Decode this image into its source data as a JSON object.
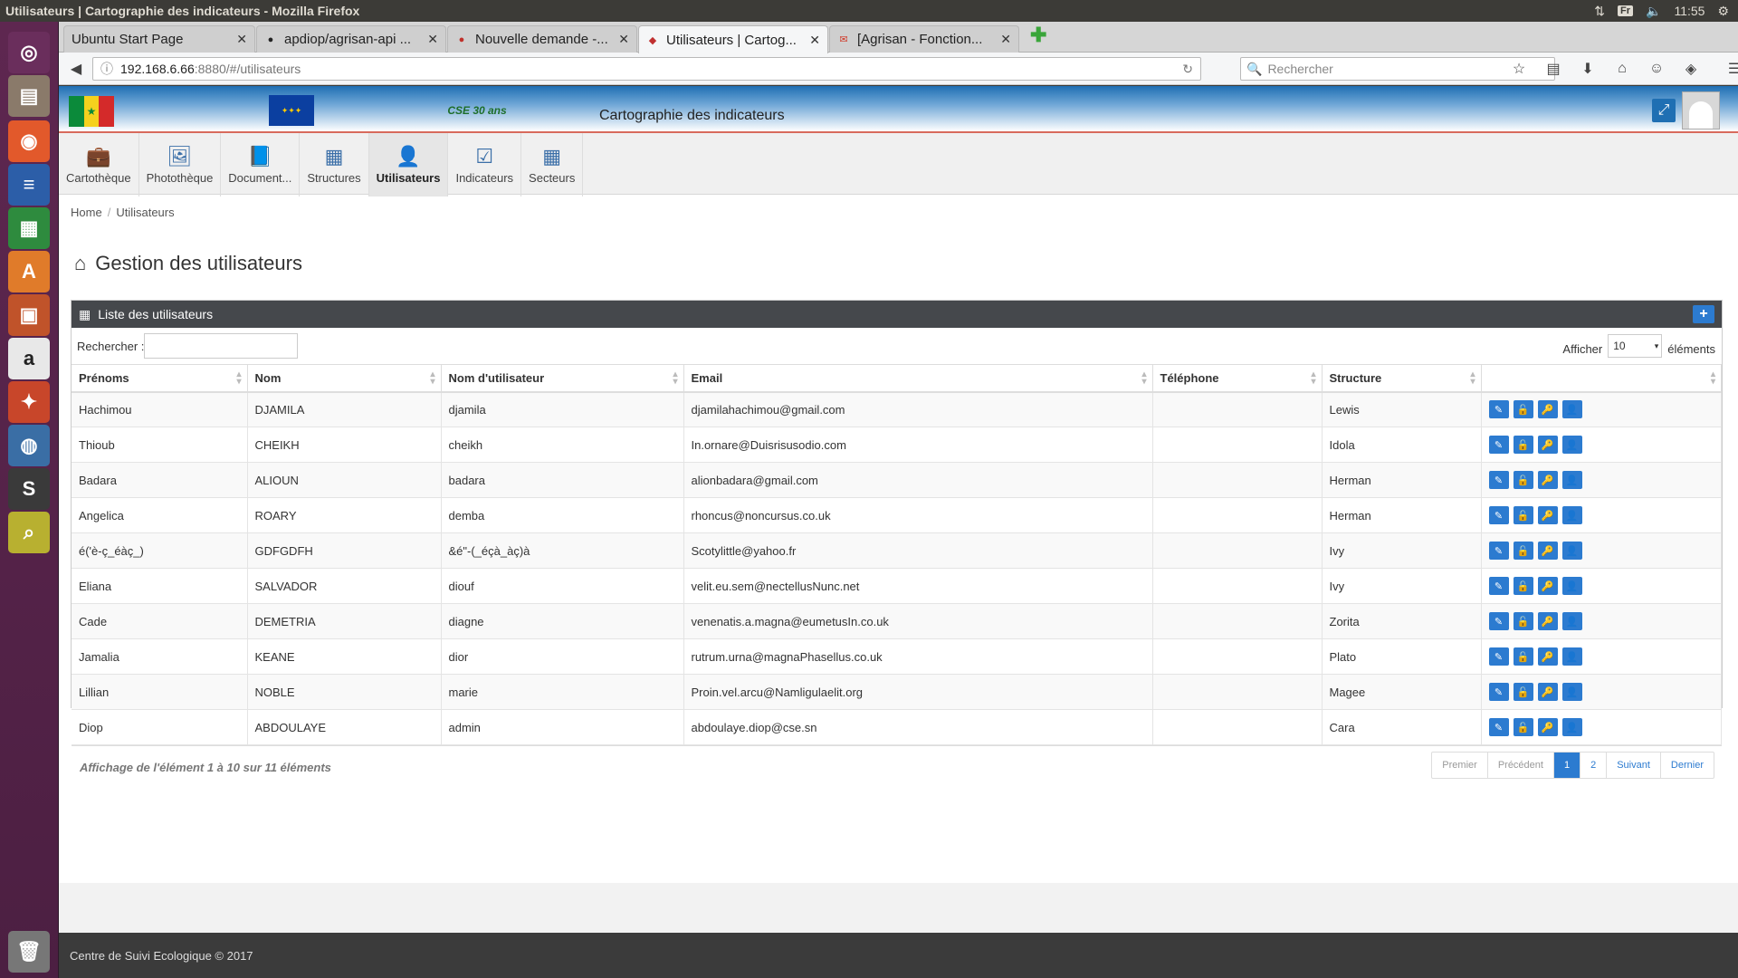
{
  "system": {
    "window_title": "Utilisateurs | Cartographie des indicateurs - Mozilla Firefox",
    "lang": "Fr",
    "time": "11:55"
  },
  "launcher": [
    {
      "name": "ubuntu-dash-icon",
      "glyph": "◎",
      "bg": "#6a2e5c"
    },
    {
      "name": "files-icon",
      "glyph": "▤",
      "bg": "#8a7a6a"
    },
    {
      "name": "firefox-icon",
      "glyph": "◉",
      "bg": "#e2592b"
    },
    {
      "name": "writer-icon",
      "glyph": "≡",
      "bg": "#2c5ea8"
    },
    {
      "name": "calc-icon",
      "glyph": "▦",
      "bg": "#2e8b3e"
    },
    {
      "name": "software-center-icon",
      "glyph": "A",
      "bg": "#e07b2a"
    },
    {
      "name": "impress-icon",
      "glyph": "▣",
      "bg": "#c0532a"
    },
    {
      "name": "amazon-icon",
      "glyph": "a",
      "bg": "#e8e8e8"
    },
    {
      "name": "settings-icon",
      "glyph": "✦",
      "bg": "#c8462a"
    },
    {
      "name": "pgadmin-icon",
      "glyph": "◍",
      "bg": "#3a6ea5"
    },
    {
      "name": "sublime-icon",
      "glyph": "S",
      "bg": "#3a3a3a"
    },
    {
      "name": "image-viewer-icon",
      "glyph": "⌕",
      "bg": "#b8b030"
    }
  ],
  "tabs": [
    {
      "label": "Ubuntu Start Page",
      "fav": ""
    },
    {
      "label": "apdiop/agrisan-api ...",
      "fav": "●"
    },
    {
      "label": "Nouvelle demande -...",
      "fav": "●"
    },
    {
      "label": "Utilisateurs | Cartog...",
      "fav": "◆"
    },
    {
      "label": "[Agrisan - Fonction...",
      "fav": "✉"
    }
  ],
  "url": {
    "host": "192.168.6.66",
    "path": ":8880/#/utilisateurs"
  },
  "search_placeholder": "Rechercher",
  "app_title": "Cartographie des indicateurs",
  "header_logo": "CSE 30 ans",
  "menu": [
    {
      "label": "Cartothèque",
      "icon": "briefcase-icon",
      "glyph": "💼"
    },
    {
      "label": "Photothèque",
      "icon": "image-icon",
      "glyph": "🖼"
    },
    {
      "label": "Document...",
      "icon": "book-icon",
      "glyph": "📘"
    },
    {
      "label": "Structures",
      "icon": "grid-icon",
      "glyph": "▦"
    },
    {
      "label": "Utilisateurs",
      "icon": "user-icon",
      "glyph": "👤"
    },
    {
      "label": "Indicateurs",
      "icon": "check-icon",
      "glyph": "☑"
    },
    {
      "label": "Secteurs",
      "icon": "grid-icon",
      "glyph": "▦"
    }
  ],
  "breadcrumb": {
    "home": "Home",
    "current": "Utilisateurs"
  },
  "page_title": "Gestion des utilisateurs",
  "panel_title": "Liste des utilisateurs",
  "table_tools": {
    "search_label": "Rechercher :",
    "show_label": "Afficher",
    "page_size": "10",
    "elements_label": "éléments"
  },
  "columns": [
    "Prénoms",
    "Nom",
    "Nom d'utilisateur",
    "Email",
    "Téléphone",
    "Structure",
    ""
  ],
  "rows": [
    [
      "Hachimou",
      "DJAMILA",
      "djamila",
      "djamilahachimou@gmail.com",
      "",
      "Lewis"
    ],
    [
      "Thioub",
      "CHEIKH",
      "cheikh",
      "In.ornare@Duisrisusodio.com",
      "",
      "Idola"
    ],
    [
      "Badara",
      "ALIOUN",
      "badara",
      "alionbadara@gmail.com",
      "",
      "Herman"
    ],
    [
      "Angelica",
      "ROARY",
      "demba",
      "rhoncus@noncursus.co.uk",
      "",
      "Herman"
    ],
    [
      "é('è-ç_éàç_)",
      "GDFGDFH",
      "&é\"-(_éçà_àç)à",
      "Scotylittle@yahoo.fr",
      "",
      "Ivy"
    ],
    [
      "Eliana",
      "SALVADOR",
      "diouf",
      "velit.eu.sem@nectellusNunc.net",
      "",
      "Ivy"
    ],
    [
      "Cade",
      "DEMETRIA",
      "diagne",
      "venenatis.a.magna@eumetusIn.co.uk",
      "",
      "Zorita"
    ],
    [
      "Jamalia",
      "KEANE",
      "dior",
      "rutrum.urna@magnaPhasellus.co.uk",
      "",
      "Plato"
    ],
    [
      "Lillian",
      "NOBLE",
      "marie",
      "Proin.vel.arcu@Namligulaelit.org",
      "",
      "Magee"
    ],
    [
      "Diop",
      "ABDOULAYE",
      "admin",
      "abdoulaye.diop@cse.sn",
      "",
      "Cara"
    ]
  ],
  "table_info": "Affichage de l'élément 1 à 10 sur 11 éléments",
  "pager": [
    "Premier",
    "Précédent",
    "1",
    "2",
    "Suivant",
    "Dernier"
  ],
  "footer": "Centre de Suivi Ecologique © 2017",
  "colors": {
    "accent": "#2c7bd0",
    "panel_head": "#45484c",
    "launcher": "#5e2750",
    "menu_border": "#d86a5c"
  }
}
